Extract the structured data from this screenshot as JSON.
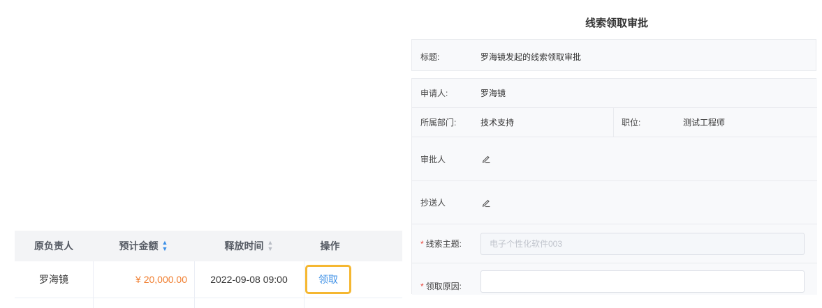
{
  "table": {
    "headers": {
      "owner": "原负责人",
      "amount": "预计金额",
      "release_time": "释放时间",
      "action": "操作"
    },
    "rows": [
      {
        "owner": "罗海镜",
        "amount": "¥ 20,000.00",
        "release_time": "2022-09-08 09:00",
        "action": "领取"
      }
    ]
  },
  "panel": {
    "title": "线索领取审批",
    "subject_label": "标题:",
    "subject_value": "罗海镜发起的线索领取审批",
    "applicant_label": "申请人:",
    "applicant_value": "罗海镜",
    "department_label": "所属部门:",
    "department_value": "技术支持",
    "position_label": "职位:",
    "position_value": "测试工程师",
    "approver_label": "审批人",
    "cc_label": "抄送人",
    "lead_topic_label": "线索主题:",
    "lead_topic_value": "电子个性化软件003",
    "claim_reason_label": "领取原因:",
    "claim_reason_value": "",
    "required_mark": "*"
  },
  "colors": {
    "amount": "#f07c2c",
    "link": "#3a8ee6",
    "highlight_border": "#f5b731",
    "required": "#e8473c"
  },
  "icons": {
    "sort_amount": "sort-icon",
    "sort_time": "sort-icon",
    "approver_edit": "pen-icon",
    "cc_edit": "pen-icon"
  }
}
